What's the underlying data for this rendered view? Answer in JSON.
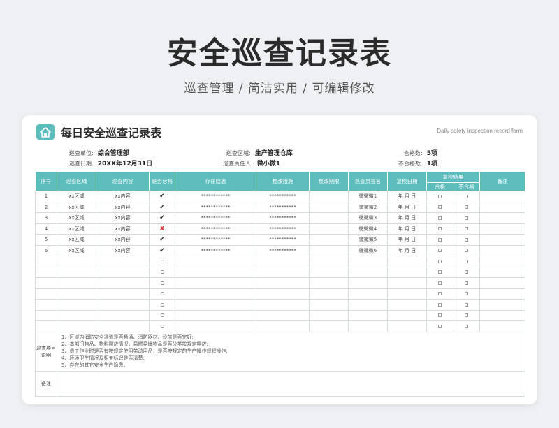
{
  "hero": {
    "title": "安全巡查记录表",
    "subtitle": "巡查管理 / 简洁实用 / 可编辑修改"
  },
  "card": {
    "title": "每日安全巡查记录表",
    "title_en": "Daily safety inspection record form",
    "icon": "home-icon"
  },
  "meta": {
    "unit_label": "巡查单位:",
    "unit_value": "综合管理部",
    "area_label": "巡查区域:",
    "area_value": "生产管理仓库",
    "pass_label": "合格数:",
    "pass_value": "5项",
    "date_label": "巡查日期:",
    "date_value": "20XX年12月31日",
    "person_label": "巡查责任人:",
    "person_value": "微小微1",
    "fail_label": "不合格数:",
    "fail_value": "1项"
  },
  "table": {
    "headers": {
      "seq": "序号",
      "area": "巡查区域",
      "content": "巡查内容",
      "qualified": "是否合格",
      "hazard": "存在隐患",
      "measure": "整改措施",
      "deadline": "整改期限",
      "signer": "巡查员签名",
      "recheck_date": "复检日期",
      "recheck_result": "复检结果",
      "note": "备注",
      "pass": "合格",
      "fail": "不合格"
    },
    "rows": [
      {
        "seq": "1",
        "area": "xx区域",
        "content": "xx内容",
        "status": "ok",
        "hazard": "************",
        "measure": "***********",
        "deadline": "",
        "signer": "微微微1",
        "date": "年 月 日"
      },
      {
        "seq": "2",
        "area": "xx区域",
        "content": "xx内容",
        "status": "ok",
        "hazard": "************",
        "measure": "***********",
        "deadline": "",
        "signer": "微微微2",
        "date": "年 月 日"
      },
      {
        "seq": "3",
        "area": "xx区域",
        "content": "xx内容",
        "status": "ok",
        "hazard": "************",
        "measure": "***********",
        "deadline": "",
        "signer": "微微微3",
        "date": "年 月 日"
      },
      {
        "seq": "4",
        "area": "xx区域",
        "content": "xx内容",
        "status": "bad",
        "hazard": "************",
        "measure": "***********",
        "deadline": "",
        "signer": "微微微4",
        "date": "年 月 日"
      },
      {
        "seq": "5",
        "area": "xx区域",
        "content": "xx内容",
        "status": "ok",
        "hazard": "************",
        "measure": "***********",
        "deadline": "",
        "signer": "微微微5",
        "date": "年 月 日"
      },
      {
        "seq": "6",
        "area": "xx区域",
        "content": "xx内容",
        "status": "ok",
        "hazard": "************",
        "measure": "***********",
        "deadline": "",
        "signer": "微微微6",
        "date": "年 月 日"
      }
    ],
    "ok_mark": "✔",
    "bad_mark": "✘"
  },
  "notes": {
    "label": "巡查项目说明",
    "items": [
      "1、区域内消防安全通道是否畅通、消防器材、设施是否完好;",
      "2、本部门物品、物料摆放情况，易燃易爆物品是否分类按规定摆放;",
      "3、员工作业时是否有按规定使用劳动用品，是否按规定的生产操作规程操作;",
      "4、环境卫生情况及相关标识是否清楚;",
      "5、存在的其它安全生产隐患。"
    ]
  },
  "remark": {
    "label": "备注"
  },
  "colors": {
    "accent": "#5dbcbc",
    "fail_mark": "#d7261e"
  }
}
